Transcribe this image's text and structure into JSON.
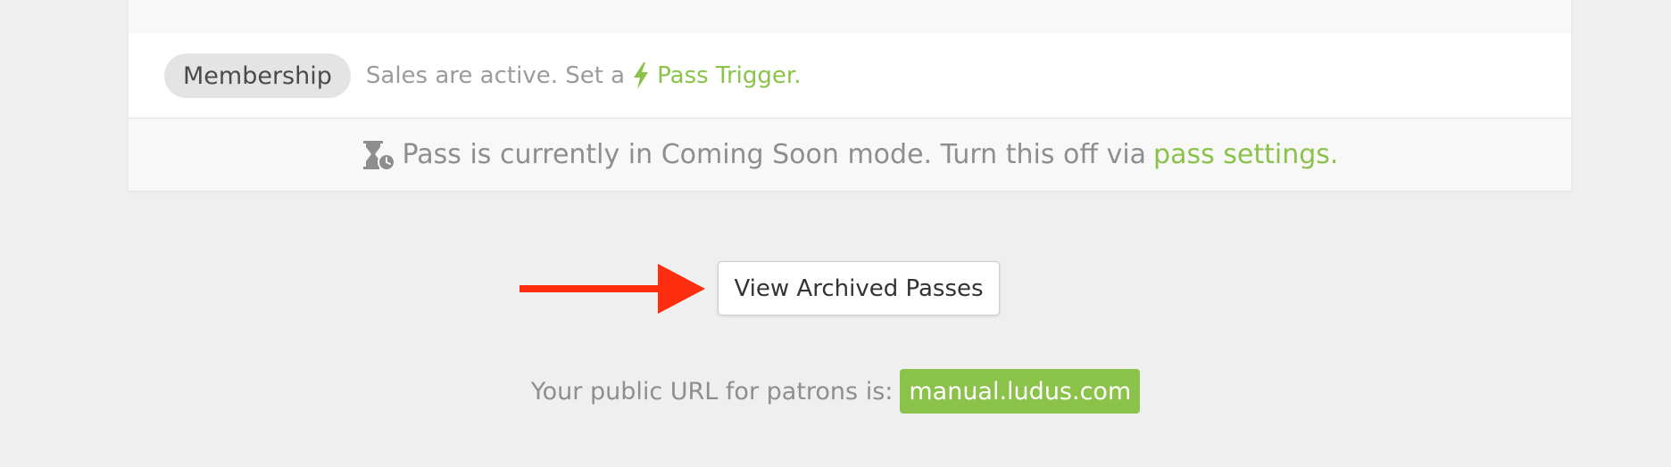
{
  "membership": {
    "badge": "Membership",
    "sales_text": "Sales are active. Set a",
    "trigger_link": "Pass Trigger."
  },
  "notice": {
    "message": "Pass is currently in Coming Soon mode. Turn this off via",
    "settings_link": "pass settings."
  },
  "archived": {
    "button_label": "View Archived Passes"
  },
  "public_url": {
    "label": "Your public URL for patrons is:",
    "url": "manual.ludus.com"
  },
  "icons": {
    "trigger": "lightning-bolt-icon",
    "notice": "hourglass-clock-icon",
    "annotation": "red-arrow-icon"
  },
  "colors": {
    "accent": "#8bc34a",
    "annotation_arrow": "#ff2d0f",
    "muted_text": "#9b9b9b",
    "badge_bg": "#e4e4e4"
  }
}
